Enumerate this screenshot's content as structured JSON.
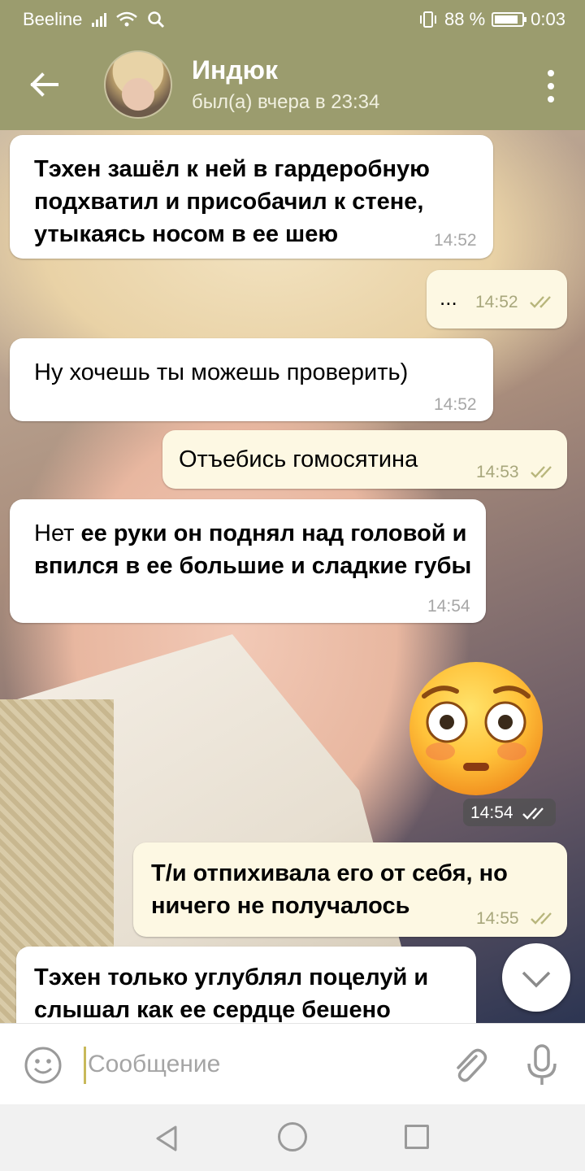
{
  "status_bar": {
    "carrier": "Beeline",
    "battery_percent": "88 %",
    "battery_level": 0.88,
    "time": "0:03"
  },
  "header": {
    "name": "Индюк",
    "last_seen": "был(а) вчера в 23:34"
  },
  "messages": [
    {
      "direction": "in",
      "text_parts": [
        "Тэхен зашёл к ней в гардеробную подхватил и присобачил к стене, утыкаясь носом в ее шею"
      ],
      "time": "14:52"
    },
    {
      "direction": "out",
      "text": "...",
      "time": "14:52",
      "read": true
    },
    {
      "direction": "in",
      "text": "Ну хочешь ты можешь проверить)",
      "time": "14:52"
    },
    {
      "direction": "out",
      "text": "Отъебись гомосятина",
      "time": "14:53",
      "read": true
    },
    {
      "direction": "in",
      "text_parts": [
        "Нет ",
        "ее руки он поднял над головой и впился в ее большие и сладкие губы"
      ],
      "time": "14:54"
    },
    {
      "direction": "out",
      "type": "sticker",
      "sticker": "flushed-face-emoji",
      "time": "14:54",
      "read": true
    },
    {
      "direction": "out",
      "text": "Т/и отпихивала его от себя, но ничего не получалось",
      "time": "14:55",
      "read": true
    },
    {
      "direction": "in",
      "text": "Тэхен только углублял поцелуй и слышал как ее сердце бешено",
      "time": ""
    }
  ],
  "composer": {
    "placeholder": "Сообщение"
  },
  "icons": {
    "back": "arrow-left-icon",
    "menu": "more-vert-icon",
    "scroll_down": "chevron-down-icon",
    "emoji": "smile-icon",
    "attach": "paperclip-icon",
    "mic": "microphone-icon",
    "read": "double-check-icon"
  },
  "colors": {
    "header": "#9b9c6e",
    "outgoing_bubble": "#fdf8e3",
    "incoming_bubble": "#ffffff",
    "check": "#a8a77c"
  }
}
